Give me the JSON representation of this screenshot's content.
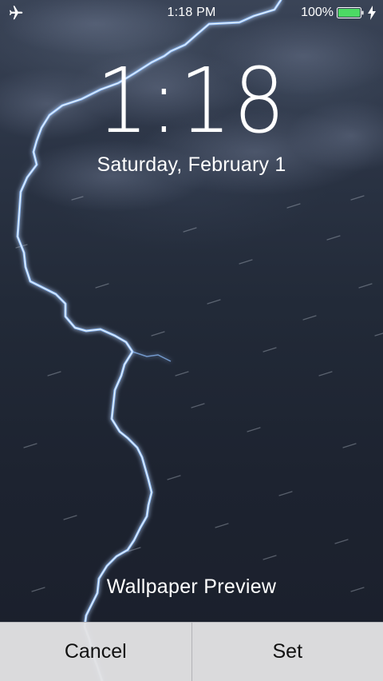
{
  "status_bar": {
    "time": "1:18 PM",
    "battery_percent": "100%",
    "airplane_icon": "airplane-icon",
    "battery_icon": "battery-full-icon",
    "charging_icon": "charging-bolt-icon",
    "battery_color": "#4cd964"
  },
  "lock_screen": {
    "time": "1:18",
    "date": "Saturday, February 1"
  },
  "wallpaper": {
    "description_icon": "lightning-storm-wallpaper",
    "sky_color": "#222a38",
    "bolt_color": "#9ec8ff"
  },
  "preview": {
    "label": "Wallpaper Preview"
  },
  "actions": {
    "cancel_label": "Cancel",
    "set_label": "Set"
  }
}
